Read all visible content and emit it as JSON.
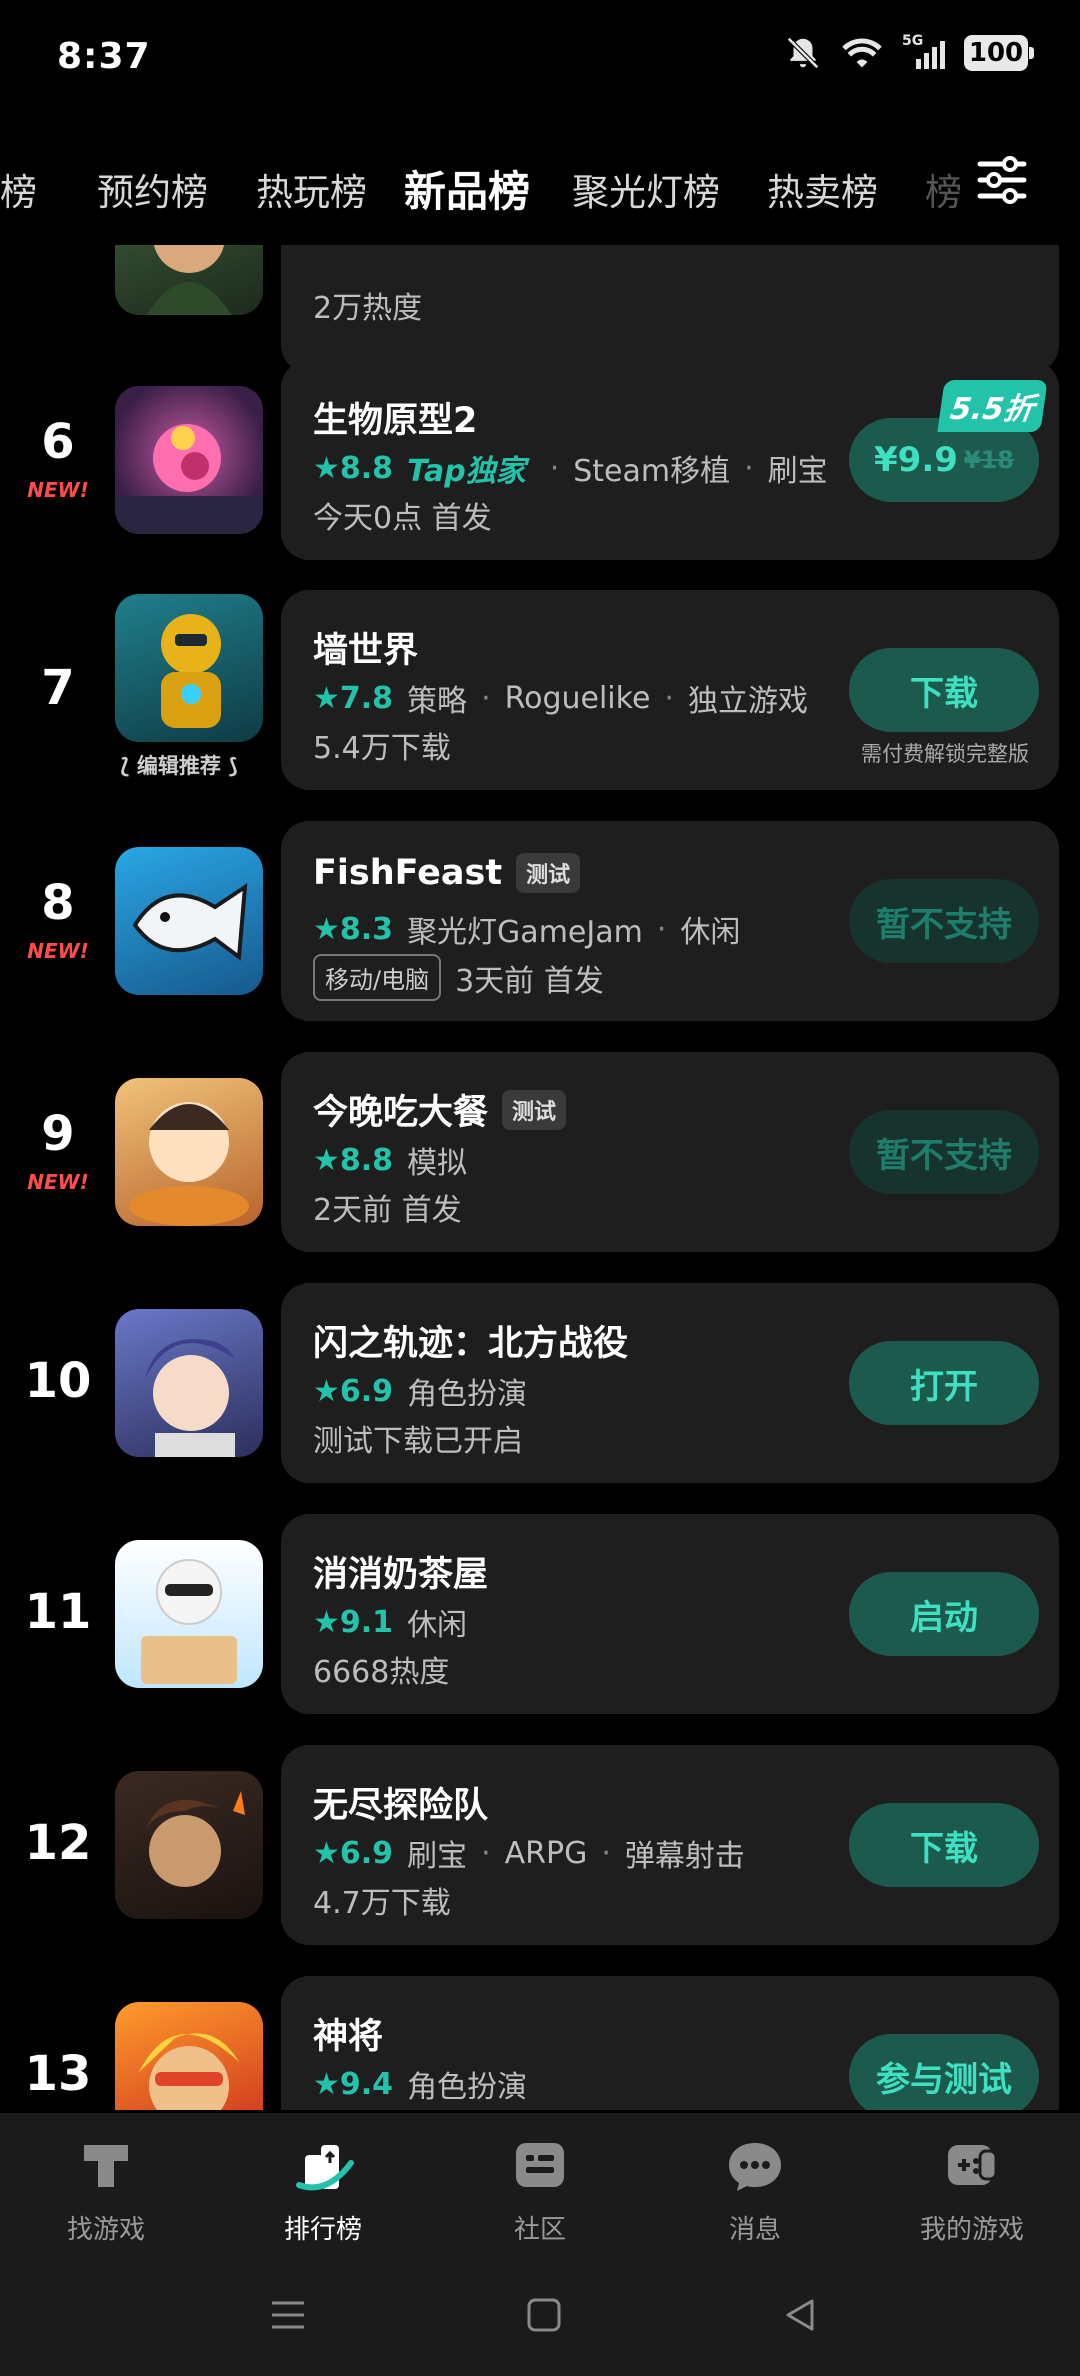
{
  "status": {
    "time": "8:37",
    "battery": "100",
    "network": "5G"
  },
  "tabs": [
    "预约榜",
    "热玩榜",
    "新品榜",
    "聚光灯榜",
    "热卖榜"
  ],
  "tabs_left_partial": "榜",
  "active_tab": "新品榜",
  "list": {
    "partial_top": {
      "sub": "2万热度"
    },
    "rows": [
      {
        "rank": "6",
        "new": "NEW!",
        "title": "生物原型2",
        "score": "8.8",
        "tap": "Tap独家",
        "tags": [
          "Steam移植",
          "刷宝"
        ],
        "sub": "今天0点 首发",
        "price_now": "¥9.9",
        "price_old": "¥18",
        "discount": "5.5折"
      },
      {
        "rank": "7",
        "title": "墙世界",
        "score": "7.8",
        "tags": [
          "策略",
          "Roguelike",
          "独立游戏"
        ],
        "sub": "5.4万下载",
        "button": "下载",
        "button_note": "需付费解锁完整版",
        "editor": "编辑推荐"
      },
      {
        "rank": "8",
        "new": "NEW!",
        "title": "FishFeast",
        "badge": "测试",
        "score": "8.3",
        "tags": [
          "聚光灯GameJam",
          "休闲"
        ],
        "platform": "移动/电脑",
        "sub": "3天前 首发",
        "button": "暂不支持"
      },
      {
        "rank": "9",
        "new": "NEW!",
        "title": "今晚吃大餐",
        "badge": "测试",
        "score": "8.8",
        "tags": [
          "模拟"
        ],
        "sub": "2天前 首发",
        "button": "暂不支持"
      },
      {
        "rank": "10",
        "title": "闪之轨迹：北方战役",
        "score": "6.9",
        "tags": [
          "角色扮演"
        ],
        "sub": "测试下载已开启",
        "button": "打开"
      },
      {
        "rank": "11",
        "title": "消消奶茶屋",
        "score": "9.1",
        "tags": [
          "休闲"
        ],
        "sub": "6668热度",
        "button": "启动"
      },
      {
        "rank": "12",
        "title": "无尽探险队",
        "score": "6.9",
        "tags": [
          "刷宝",
          "ARPG",
          "弹幕射击"
        ],
        "sub": "4.7万下载",
        "button": "下载"
      },
      {
        "rank": "13",
        "title": "神将",
        "score": "9.4",
        "tags": [
          "角色扮演"
        ],
        "button": "参与测试"
      }
    ]
  },
  "nav": [
    {
      "label": "找游戏",
      "icon": "find-game-icon"
    },
    {
      "label": "排行榜",
      "icon": "ranking-icon"
    },
    {
      "label": "社区",
      "icon": "community-icon"
    },
    {
      "label": "消息",
      "icon": "message-icon"
    },
    {
      "label": "我的游戏",
      "icon": "my-games-icon"
    }
  ],
  "colors": {
    "accent": "#23c2aa",
    "card": "#1e1e1e",
    "button_bg": "#1d5a4e",
    "new": "#ff4d4d"
  }
}
